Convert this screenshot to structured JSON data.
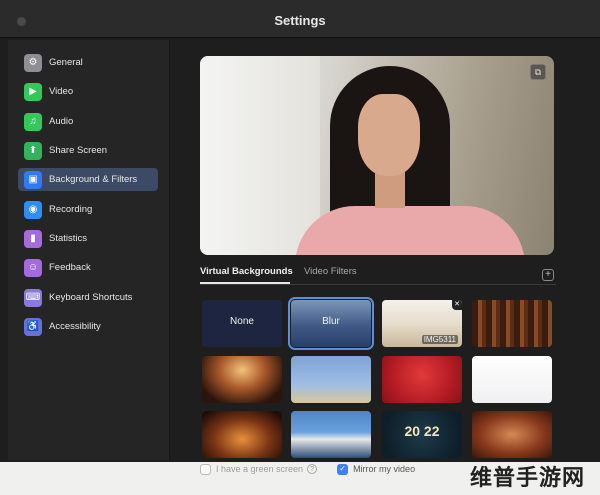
{
  "window": {
    "title": "Settings"
  },
  "sidebar": {
    "items": [
      {
        "label": "General",
        "icon": "gear-icon",
        "color": "#8e8e93",
        "glyph": "⚙",
        "active": false
      },
      {
        "label": "Video",
        "icon": "video-camera-icon",
        "color": "#34c759",
        "glyph": "▶",
        "active": false
      },
      {
        "label": "Audio",
        "icon": "headphones-icon",
        "color": "#34c759",
        "glyph": "♫",
        "active": false
      },
      {
        "label": "Share Screen",
        "icon": "share-screen-icon",
        "color": "#30b35a",
        "glyph": "⬆",
        "active": false
      },
      {
        "label": "Background & Filters",
        "icon": "background-icon",
        "color": "#2f7bf5",
        "glyph": "▣",
        "active": true
      },
      {
        "label": "Recording",
        "icon": "recording-icon",
        "color": "#2f8ef5",
        "glyph": "◉",
        "active": false
      },
      {
        "label": "Statistics",
        "icon": "statistics-icon",
        "color": "#a46bde",
        "glyph": "▮",
        "active": false
      },
      {
        "label": "Feedback",
        "icon": "feedback-icon",
        "color": "#a46bde",
        "glyph": "☺",
        "active": false
      },
      {
        "label": "Keyboard Shortcuts",
        "icon": "keyboard-icon",
        "color": "#8a7bd8",
        "glyph": "⌨",
        "active": false
      },
      {
        "label": "Accessibility",
        "icon": "accessibility-icon",
        "color": "#6b6fd8",
        "glyph": "♿",
        "active": false
      }
    ]
  },
  "main": {
    "tabs": [
      {
        "label": "Virtual Backgrounds",
        "active": true
      },
      {
        "label": "Video Filters",
        "active": false
      }
    ],
    "backgrounds": [
      {
        "label": "None",
        "kind": "none"
      },
      {
        "label": "Blur",
        "kind": "blur",
        "selected": true
      },
      {
        "label": "",
        "kind": "image-office",
        "caption": "IMG5311"
      },
      {
        "label": "",
        "kind": "image-library"
      },
      {
        "label": "",
        "kind": "image-hall"
      },
      {
        "label": "",
        "kind": "image-sky"
      },
      {
        "label": "",
        "kind": "image-red"
      },
      {
        "label": "",
        "kind": "image-white"
      },
      {
        "label": "",
        "kind": "image-lights"
      },
      {
        "label": "",
        "kind": "image-opera"
      },
      {
        "label": "",
        "kind": "image-2022"
      },
      {
        "label": "",
        "kind": "image-room"
      }
    ],
    "green_screen_label": "I have a green screen",
    "mirror_label": "Mirror my video",
    "green_screen_checked": false,
    "mirror_checked": true
  },
  "watermark": "维普手游网",
  "colors": {
    "accent": "#3b82f6",
    "selection": "#5b8fd6",
    "active_item": "#3c4a66"
  }
}
